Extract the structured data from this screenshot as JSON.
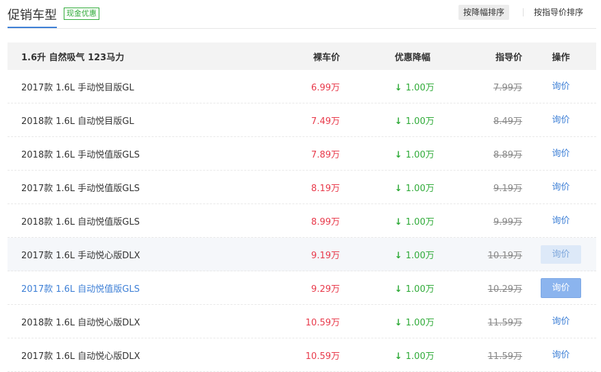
{
  "header": {
    "title": "促销车型",
    "badge": "现金优惠",
    "sort_drop": "按降幅排序",
    "sort_guide": "按指导价排序"
  },
  "table": {
    "group_label": "1.6升 自然吸气 123马力",
    "columns": {
      "price": "裸车价",
      "discount": "优惠降幅",
      "guide": "指导价",
      "action": "操作"
    },
    "rows": [
      {
        "name": "2017款 1.6L 手动悦目版GL",
        "price": "6.99万",
        "discount": "1.00万",
        "guide": "7.99万",
        "action": "询价"
      },
      {
        "name": "2018款 1.6L 自动悦目版GL",
        "price": "7.49万",
        "discount": "1.00万",
        "guide": "8.49万",
        "action": "询价"
      },
      {
        "name": "2018款 1.6L 手动悦值版GLS",
        "price": "7.89万",
        "discount": "1.00万",
        "guide": "8.89万",
        "action": "询价"
      },
      {
        "name": "2017款 1.6L 手动悦值版GLS",
        "price": "8.19万",
        "discount": "1.00万",
        "guide": "9.19万",
        "action": "询价"
      },
      {
        "name": "2018款 1.6L 自动悦值版GLS",
        "price": "8.99万",
        "discount": "1.00万",
        "guide": "9.99万",
        "action": "询价"
      },
      {
        "name": "2017款 1.6L 手动悦心版DLX",
        "price": "9.19万",
        "discount": "1.00万",
        "guide": "10.19万",
        "action": "询价"
      },
      {
        "name": "2017款 1.6L 自动悦值版GLS",
        "price": "9.29万",
        "discount": "1.00万",
        "guide": "10.29万",
        "action": "询价"
      },
      {
        "name": "2018款 1.6L 自动悦心版DLX",
        "price": "10.59万",
        "discount": "1.00万",
        "guide": "11.59万",
        "action": "询价"
      },
      {
        "name": "2017款 1.6L 自动悦心版DLX",
        "price": "10.59万",
        "discount": "1.00万",
        "guide": "11.59万",
        "action": "询价"
      }
    ]
  },
  "icons": {
    "discount_arrow": "down-arrow-icon",
    "arrow_glyph": "↓"
  },
  "colors": {
    "accent": "#3d7fd6",
    "price": "#e8394a",
    "discount": "#2eaa37",
    "badge": "#2eaa37"
  }
}
